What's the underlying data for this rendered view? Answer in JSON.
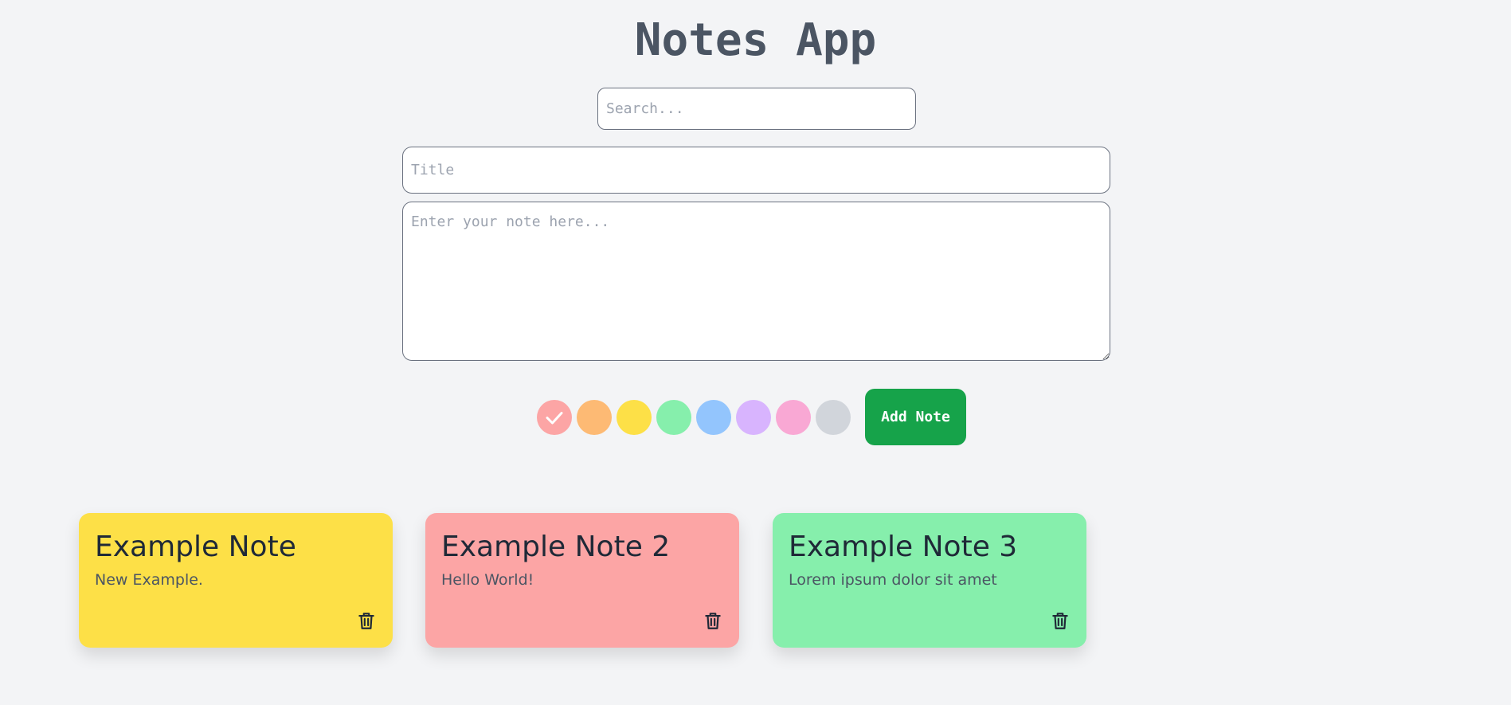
{
  "app": {
    "title": "Notes App"
  },
  "search": {
    "placeholder": "Search..."
  },
  "editor": {
    "title_placeholder": "Title",
    "body_placeholder": "Enter your note here..."
  },
  "color_picker": {
    "selected": "red",
    "colors": [
      {
        "name": "red",
        "hex": "#fca5a5"
      },
      {
        "name": "orange",
        "hex": "#fdba74"
      },
      {
        "name": "yellow",
        "hex": "#fde047"
      },
      {
        "name": "green",
        "hex": "#86efac"
      },
      {
        "name": "blue",
        "hex": "#93c5fd"
      },
      {
        "name": "purple",
        "hex": "#d8b4fe"
      },
      {
        "name": "pink",
        "hex": "#f9a8d4"
      },
      {
        "name": "gray",
        "hex": "#d1d5db"
      }
    ]
  },
  "add_button": {
    "label": "Add Note",
    "color": "#16a34a"
  },
  "notes": [
    {
      "title": "Example Note",
      "body": "New Example.",
      "color": "#fde047",
      "delete_icon": "trash-icon"
    },
    {
      "title": "Example Note 2",
      "body": "Hello World!",
      "color": "#fca5a5",
      "delete_icon": "trash-icon"
    },
    {
      "title": "Example Note 3",
      "body": "Lorem ipsum dolor sit amet",
      "color": "#86efac",
      "delete_icon": "trash-icon"
    }
  ]
}
